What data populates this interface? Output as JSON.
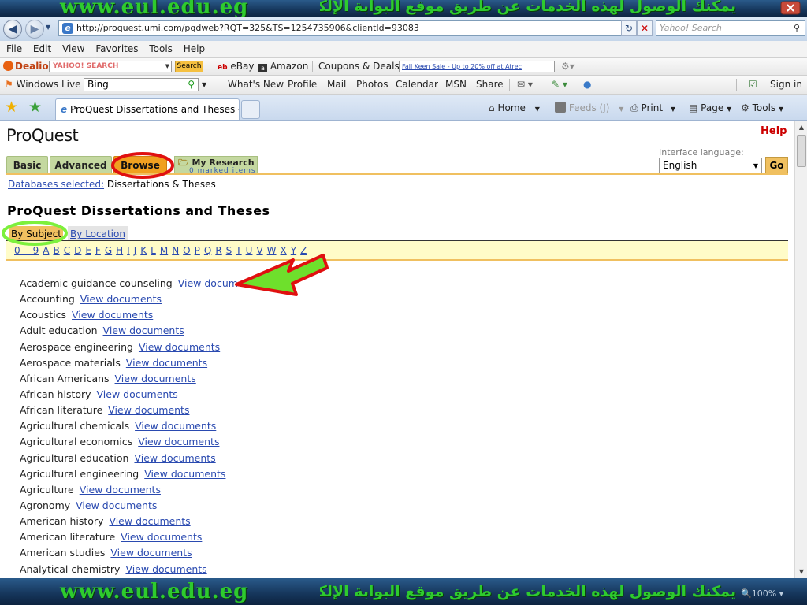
{
  "banner": {
    "url": "www.eul.edu.eg",
    "arabic": "يمكنك الوصول لهذه الخدمات عن طريق موقع البوابة الإلكترونية"
  },
  "browser": {
    "address": "http://proquest.umi.com/pqdweb?RQT=325&TS=1254735906&clientId=93083",
    "search_placeholder": "Yahoo! Search",
    "menu": [
      "File",
      "Edit",
      "View",
      "Favorites",
      "Tools",
      "Help"
    ],
    "toolbar1": {
      "dealio": "Dealio",
      "search_btn": "Search",
      "ebay": "eBay",
      "amazon": "Amazon",
      "coupons": "Coupons & Deals",
      "promo": "Fall Keen Sale - Up to 20% off at Atrec"
    },
    "toolbar2": {
      "windows_live": "Windows Live",
      "bing": "Bing",
      "links": [
        "What's New",
        "Profile",
        "Mail",
        "Photos",
        "Calendar",
        "MSN",
        "Share"
      ],
      "signin": "Sign in"
    },
    "tab_title": "ProQuest Dissertations and Theses - Pr...",
    "tools": {
      "home": "Home",
      "feeds": "Feeds (J)",
      "print": "Print",
      "page": "Page",
      "tools": "Tools"
    },
    "zoom": "100%"
  },
  "page": {
    "logo": "ProQuest",
    "help": "Help",
    "lang_label": "Interface language:",
    "lang_value": "English",
    "go": "Go",
    "tabs": {
      "basic": "Basic",
      "advanced": "Advanced",
      "browse": "Browse",
      "my_research": "My Research",
      "marked": "0 marked items"
    },
    "db_label": "Databases selected:",
    "db_value": "Dissertations & Theses",
    "title": "ProQuest Dissertations and Theses",
    "by_subject": "By Subject",
    "by_location": "By Location",
    "alphabet": [
      "0 - 9",
      "A",
      "B",
      "C",
      "D",
      "E",
      "F",
      "G",
      "H",
      "I",
      "J",
      "K",
      "L",
      "M",
      "N",
      "O",
      "P",
      "Q",
      "R",
      "S",
      "T",
      "U",
      "V",
      "W",
      "X",
      "Y",
      "Z"
    ],
    "view_label": "View documents",
    "subjects": [
      "Academic guidance counseling",
      "Accounting",
      "Acoustics",
      "Adult education",
      "Aerospace engineering",
      "Aerospace materials",
      "African Americans",
      "African history",
      "African literature",
      "Agricultural chemicals",
      "Agricultural economics",
      "Agricultural education",
      "Agricultural engineering",
      "Agriculture",
      "Agronomy",
      "American history",
      "American literature",
      "American studies",
      "Analytical chemistry"
    ]
  },
  "colors": {
    "banner_text": "#2ecb2e",
    "browse_tab": "#f0a020",
    "tab_green": "#c4d8a0",
    "link": "#2a4ab0",
    "highlight_red": "#e01010",
    "highlight_green": "#7cf03c"
  }
}
